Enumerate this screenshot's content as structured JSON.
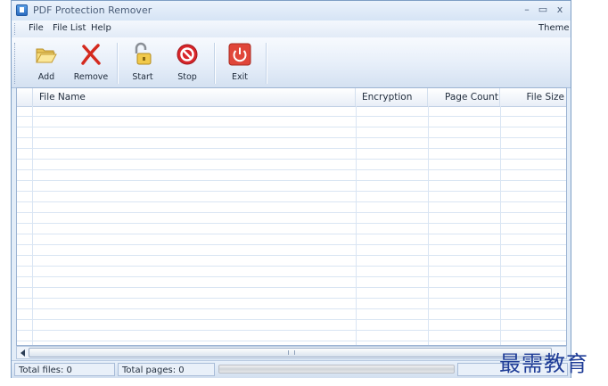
{
  "window": {
    "title": "PDF Protection Remover",
    "controls": {
      "minimize": "–",
      "maximize": "▭",
      "close": "x"
    }
  },
  "menu": {
    "items": [
      "File",
      "File List",
      "Help"
    ],
    "theme": "Theme"
  },
  "toolbar": {
    "buttons": [
      {
        "label": "Add",
        "icon": "folder-open-icon"
      },
      {
        "label": "Remove",
        "icon": "red-x-icon"
      },
      {
        "label": "Start",
        "icon": "unlock-padlock-icon"
      },
      {
        "label": "Stop",
        "icon": "stop-sign-icon"
      },
      {
        "label": "Exit",
        "icon": "power-icon"
      }
    ]
  },
  "grid": {
    "columns": [
      "File Name",
      "Encryption",
      "Page Count",
      "File Size"
    ],
    "rows": []
  },
  "status": {
    "total_files": "Total files: 0",
    "total_pages": "Total pages: 0",
    "progress": 0
  },
  "watermark": "最需教育",
  "colors": {
    "accent": "#2b6cc0",
    "stop_red": "#d8262b",
    "exit_red": "#e0463a"
  }
}
